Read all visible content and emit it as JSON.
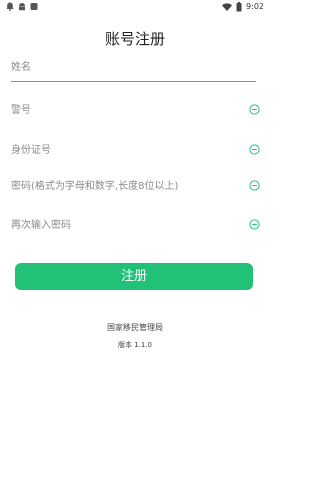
{
  "status_bar": {
    "time": "9:02",
    "left_icons": [
      "notification-icon",
      "android-icon",
      "app-icon"
    ],
    "right_icons": [
      "wifi-icon",
      "battery-icon"
    ]
  },
  "page": {
    "title": "账号注册"
  },
  "form": {
    "name_placeholder": "姓名",
    "police_id_placeholder": "警号",
    "id_card_placeholder": "身份证号",
    "password_placeholder": "密码(格式为字母和数字,长度8位以上)",
    "confirm_password_placeholder": "再次输入密码",
    "clear_icon": "clear-icon",
    "accent_color": "#2bbf80"
  },
  "actions": {
    "register_label": "注册",
    "register_color": "#22c178"
  },
  "footer": {
    "organization": "国家移民管理局",
    "version": "版本 1.1.0"
  }
}
